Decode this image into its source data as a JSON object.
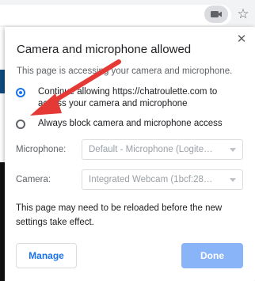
{
  "popup": {
    "title": "Camera and microphone allowed",
    "subtitle": "This page is accessing your camera and microphone.",
    "options": [
      {
        "label": "Continue allowing https://chatroulette.com to access your camera and microphone",
        "selected": true
      },
      {
        "label": "Always block camera and microphone access",
        "selected": false
      }
    ],
    "microphone_label": "Microphone:",
    "microphone_value": "Default - Microphone (Logite…",
    "camera_label": "Camera:",
    "camera_value": "Integrated Webcam (1bcf:28…",
    "note": "This page may need to be reloaded before the new settings take effect.",
    "manage_label": "Manage",
    "done_label": "Done",
    "close_glyph": "✕"
  },
  "toolbar": {
    "star_glyph": "☆"
  },
  "colors": {
    "accent": "#1a73e8",
    "done_button": "#8ab4f8",
    "annotation_arrow": "#e53935"
  },
  "icons": {
    "camera_chip": "video-camera-icon",
    "bookmark": "star-icon",
    "close": "close-icon"
  }
}
